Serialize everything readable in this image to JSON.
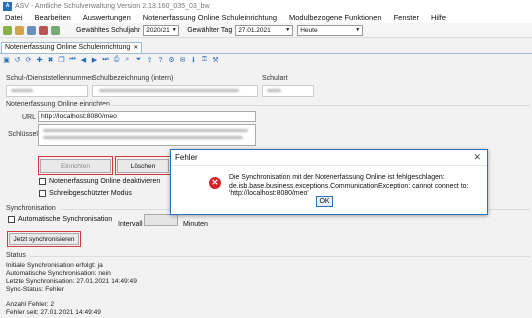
{
  "titlebar": {
    "title": "ASV - Amtliche Schulverwaltung Version 2.13.160_035_03_bw"
  },
  "menu": {
    "items": [
      "Datei",
      "Bearbeiten",
      "Auswertungen",
      "Notenerfassung Online Schuleinrichtung",
      "Modulbezogene Funktionen",
      "Fenster",
      "Hilfe"
    ]
  },
  "filters": {
    "schuljahr_label": "Gewähltes Schuljahr",
    "schuljahr_value": "2020/21",
    "tag_label": "Gewählter Tag",
    "tag_value": "27.01.2021",
    "heute_value": "Heute"
  },
  "tab": {
    "label": "Notenerfassung Online Schuleinrichtung"
  },
  "header": {
    "schulnummer_label": "Schul-/Dienststellennummer",
    "bezeichnung_label": "Schulbezeichnung (intern)",
    "schulart_label": "Schulart"
  },
  "config": {
    "section_title": "Notenerfassung Online einrichten",
    "url_label": "URL",
    "url_value": "http://localhost:8080/meo",
    "key_label": "Schlüssel",
    "einrichten_label": "Einrichten",
    "loeschen_label": "Löschen",
    "deaktivieren_label": "Notenerfassung Online deaktivieren",
    "schreibschutz_label": "Schreibgeschützter Modus"
  },
  "sync": {
    "section_title": "Synchronisation",
    "auto_label": "Automatische Synchronisation",
    "intervall_label": "Intervall",
    "minuten_label": "Minuten",
    "jetzt_label": "Jetzt synchronisieren"
  },
  "status": {
    "section_title": "Status",
    "lines": [
      "Initiale Synchronisation erfolgt: ja",
      "Automatische Synchronisation: nein",
      "Letzte Synchronisation: 27.01.2021 14:49:49",
      "Sync-Status: Fehler",
      "",
      "Anzahl Fehler: 2",
      "Fehler seit: 27.01.2021 14:49:49"
    ]
  },
  "dialog": {
    "title": "Fehler",
    "message_line1": "Die Synchronisation mit der Notenerfassung Online ist fehlgeschlagen:",
    "message_line2": "de.isb.base.business.exceptions.CommunicationException: cannot connect to: 'http://localhost:8080/meo'",
    "ok_label": "OK"
  },
  "colors": {
    "highlight": "#d23b3b",
    "error": "#d8232a",
    "accent": "#2b6fb7"
  }
}
